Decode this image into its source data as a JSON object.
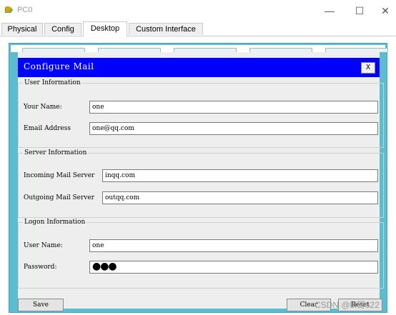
{
  "window": {
    "title": "PC0",
    "minimize": "—",
    "maximize": "☐",
    "close": "✕"
  },
  "tabs": [
    {
      "label": "Physical",
      "active": false
    },
    {
      "label": "Config",
      "active": false
    },
    {
      "label": "Desktop",
      "active": true
    },
    {
      "label": "Custom Interface",
      "active": false
    }
  ],
  "mail": {
    "title": "Configure Mail",
    "close_label": "X",
    "user_info": {
      "legend": "User Information",
      "name_label": "Your Name:",
      "name_value": "one",
      "email_label": "Email Address",
      "email_value": "one@qq.com"
    },
    "server_info": {
      "legend": "Server Information",
      "incoming_label": "Incoming Mail Server",
      "incoming_value": "inqq.com",
      "outgoing_label": "Outgoing Mail Server",
      "outgoing_value": "outqq.com"
    },
    "logon_info": {
      "legend": "Logon Information",
      "user_label": "User Name:",
      "user_value": "one",
      "password_label": "Password:",
      "password_value": "●●●"
    },
    "buttons": {
      "save": "Save",
      "clear": "Clear",
      "reset": "Reset"
    }
  },
  "watermark": "CSDN @bi哥622",
  "colors": {
    "title_bar": "#0000ff",
    "desktop_frame": "#5bbdd0",
    "panel": "#eeeeee"
  }
}
